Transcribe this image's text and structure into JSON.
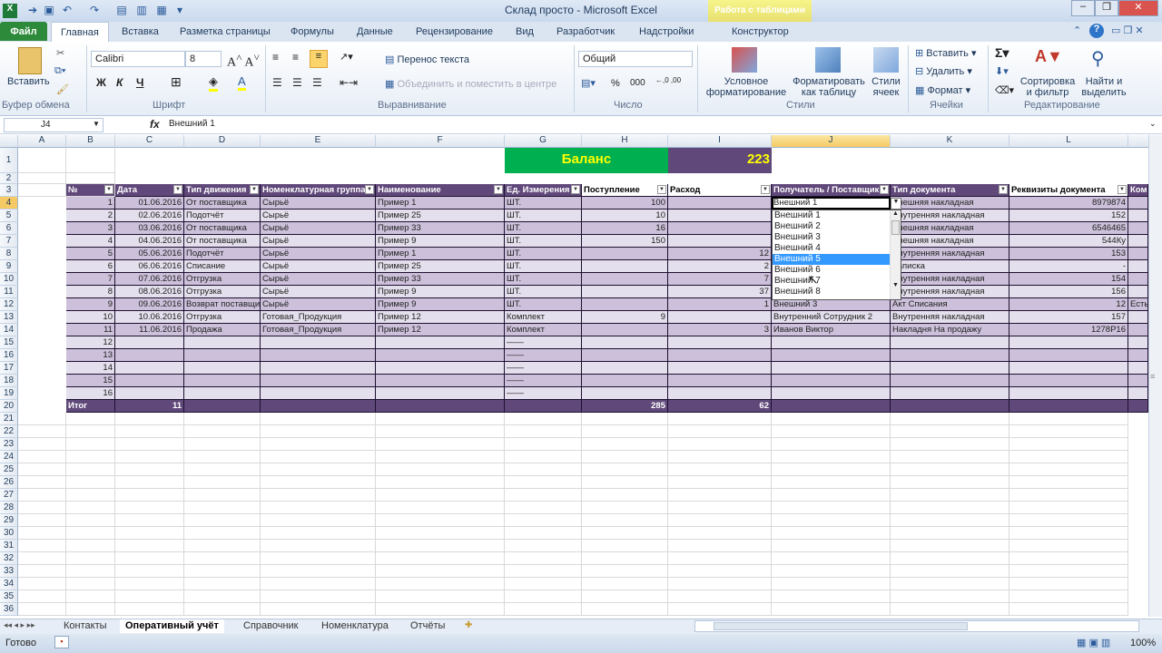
{
  "window": {
    "title": "Склад просто  -  Microsoft Excel",
    "contextual_tab": "Работа с таблицами"
  },
  "tabs": [
    "Файл",
    "Главная",
    "Вставка",
    "Разметка страницы",
    "Формулы",
    "Данные",
    "Рецензирование",
    "Вид",
    "Разработчик",
    "Надстройки",
    "Конструктор"
  ],
  "ribbon": {
    "clipboard": {
      "paste": "Вставить",
      "group": "Буфер обмена"
    },
    "font": {
      "name": "Calibri",
      "size": "8",
      "bold": "Ж",
      "italic": "К",
      "underline": "Ч",
      "group": "Шрифт"
    },
    "alignment": {
      "wrap": "Перенос текста",
      "merge": "Объединить и поместить в центре",
      "group": "Выравнивание"
    },
    "number": {
      "format": "Общий",
      "percent": "%",
      "thousands": "000",
      "group": "Число"
    },
    "styles": {
      "conditional": "Условное форматирование",
      "format_table": "Форматировать как таблицу",
      "cell_styles": "Стили ячеек",
      "group": "Стили"
    },
    "cells": {
      "insert": "Вставить",
      "delete": "Удалить",
      "format": "Формат",
      "group": "Ячейки"
    },
    "editing": {
      "sort": "Сортировка и фильтр",
      "find": "Найти и выделить",
      "group": "Редактирование"
    }
  },
  "formula_bar": {
    "name_box": "J4",
    "fx": "fx",
    "value": "Внешний 1"
  },
  "columns": [
    "A",
    "B",
    "C",
    "D",
    "E",
    "F",
    "G",
    "H",
    "I",
    "J",
    "K",
    "L"
  ],
  "balance": {
    "label": "Баланс",
    "value": "223"
  },
  "table": {
    "headers": [
      "№",
      "Дата",
      "Тип движения",
      "Номенклатурная группа",
      "Наименование",
      "Ед. Измерения",
      "Поступление",
      "Расход",
      "Получатель / Поставщик",
      "Тип документа",
      "Реквизиты документа",
      "Ком"
    ],
    "rows": [
      [
        "1",
        "01.06.2016",
        "От поставщика",
        "Сырьё",
        "Пример 1",
        "ШТ.",
        "100",
        "",
        "Внешний 1",
        "Внешняя накладная",
        "8979874",
        ""
      ],
      [
        "2",
        "02.06.2016",
        "Подотчёт",
        "Сырьё",
        "Пример 25",
        "ШТ.",
        "10",
        "",
        "",
        "Внутренняя накладная",
        "152",
        ""
      ],
      [
        "3",
        "03.06.2016",
        "От поставщика",
        "Сырьё",
        "Пример 33",
        "ШТ.",
        "16",
        "",
        "",
        "Внешняя накладная",
        "6546465",
        ""
      ],
      [
        "4",
        "04.06.2016",
        "От поставщика",
        "Сырьё",
        "Пример 9",
        "ШТ.",
        "150",
        "",
        "",
        "Внешняя накладная",
        "544Ку",
        ""
      ],
      [
        "5",
        "05.06.2016",
        "Подотчёт",
        "Сырьё",
        "Пример 1",
        "ШТ.",
        "",
        "12",
        "",
        "Внутренняя накладная",
        "153",
        ""
      ],
      [
        "6",
        "06.06.2016",
        "Списание",
        "Сырьё",
        "Пример 25",
        "ШТ.",
        "",
        "2",
        "",
        "Записка",
        "-",
        ""
      ],
      [
        "7",
        "07.06.2016",
        "Отгрузка",
        "Сырьё",
        "Пример 33",
        "ШТ.",
        "",
        "7",
        "",
        "Внутренняя накладная",
        "154",
        ""
      ],
      [
        "8",
        "08.06.2016",
        "Отгрузка",
        "Сырьё",
        "Пример 9",
        "ШТ.",
        "",
        "37",
        "",
        "Внутренняя накладная",
        "156",
        ""
      ],
      [
        "9",
        "09.06.2016",
        "Возврат поставщику",
        "Сырьё",
        "Пример 9",
        "ШТ.",
        "",
        "1",
        "Внешний 3",
        "Акт Списания",
        "12",
        "Есть"
      ],
      [
        "10",
        "10.06.2016",
        "Отгрузка",
        "Готовая_Продукция",
        "Пример 12",
        "Комплект",
        "9",
        "",
        "Внутренний Сотрудник 2",
        "Внутренняя накладная",
        "157",
        ""
      ],
      [
        "11",
        "11.06.2016",
        "Продажа",
        "Готовая_Продукция",
        "Пример 12",
        "Комплект",
        "",
        "3",
        "Иванов Виктор",
        "Накладня На продажу",
        "1278Р16",
        ""
      ],
      [
        "12",
        "",
        "",
        "",
        "",
        "——",
        "",
        "",
        "",
        "",
        "",
        ""
      ],
      [
        "13",
        "",
        "",
        "",
        "",
        "——",
        "",
        "",
        "",
        "",
        "",
        ""
      ],
      [
        "14",
        "",
        "",
        "",
        "",
        "——",
        "",
        "",
        "",
        "",
        "",
        ""
      ],
      [
        "15",
        "",
        "",
        "",
        "",
        "——",
        "",
        "",
        "",
        "",
        "",
        ""
      ],
      [
        "16",
        "",
        "",
        "",
        "",
        "——",
        "",
        "",
        "",
        "",
        "",
        ""
      ]
    ],
    "totals": [
      "Итог",
      "11",
      "",
      "",
      "",
      "",
      "285",
      "62",
      "",
      "",
      "",
      ""
    ]
  },
  "dropdown": {
    "items": [
      "Внешний 1",
      "Внешний 2",
      "Внешний 3",
      "Внешний 4",
      "Внешний 5",
      "Внешний 6",
      "Внешний 7",
      "Внешний 8"
    ],
    "selected_index": 4
  },
  "sheets": [
    "Контакты",
    "Оперативный учёт",
    "Справочник",
    "Номенклатура",
    "Отчёты"
  ],
  "active_sheet": "Оперативный учёт",
  "status": {
    "ready": "Готово",
    "zoom": "100%"
  },
  "colors": {
    "header": "#60497a",
    "band1": "#ccc0da",
    "band2": "#e4dfec",
    "balance_green": "#00b050",
    "balance_text": "#ffff00"
  }
}
